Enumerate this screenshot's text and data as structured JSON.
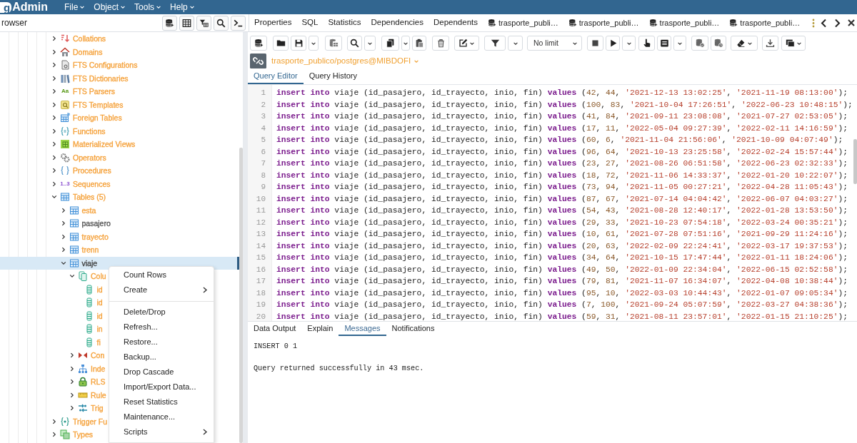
{
  "header": {
    "logo_badge": "g",
    "logo_text": "Admin",
    "menus": [
      "File",
      "Object",
      "Tools",
      "Help"
    ]
  },
  "browser": {
    "title": "rowser",
    "tree": [
      {
        "label": "Collations",
        "kind": "collation",
        "color": "#f5a23c",
        "expanded": false,
        "selected": false
      },
      {
        "label": "Domains",
        "kind": "domain",
        "color": "#f5a23c",
        "expanded": false,
        "selected": false
      },
      {
        "label": "FTS Configurations",
        "kind": "ftsconfig",
        "color": "#f5a23c",
        "expanded": false,
        "selected": false
      },
      {
        "label": "FTS Dictionaries",
        "kind": "ftsdict",
        "color": "#f5a23c",
        "expanded": false,
        "selected": false
      },
      {
        "label": "FTS Parsers",
        "kind": "ftsparser",
        "glyph": "Aa",
        "color": "#f5a23c",
        "expanded": false,
        "selected": false
      },
      {
        "label": "FTS Templates",
        "kind": "ftstemplate",
        "color": "#f5a23c",
        "expanded": false,
        "selected": false
      },
      {
        "label": "Foreign Tables",
        "kind": "foreigntable",
        "color": "#f5a23c",
        "expanded": false,
        "selected": false
      },
      {
        "label": "Functions",
        "kind": "function",
        "color": "#f5a23c",
        "expanded": false,
        "selected": false
      },
      {
        "label": "Materialized Views",
        "kind": "matview",
        "color": "#f5a23c",
        "expanded": false,
        "selected": false
      },
      {
        "label": "Operators",
        "kind": "operator",
        "color": "#f5a23c",
        "expanded": false,
        "selected": false
      },
      {
        "label": "Procedures",
        "kind": "procedure",
        "color": "#f5a23c",
        "expanded": false,
        "selected": false
      },
      {
        "label": "Sequences",
        "kind": "sequence",
        "glyph": "1..3",
        "color": "#f5a23c",
        "expanded": false,
        "selected": false
      },
      {
        "label": "Tables (5)",
        "kind": "tables",
        "color": "#f5a23c",
        "expanded": true,
        "selected": false,
        "children": [
          {
            "label": "esta",
            "kind": "table",
            "color": "#f5a23c",
            "expanded": false,
            "selected": false
          },
          {
            "label": "pasajero",
            "kind": "table",
            "color": "#555555",
            "expanded": false,
            "selected": false
          },
          {
            "label": "trayecto",
            "kind": "table",
            "color": "#f5a23c",
            "expanded": false,
            "selected": false
          },
          {
            "label": "trenn",
            "kind": "table",
            "color": "#f5a23c",
            "expanded": false,
            "selected": false
          },
          {
            "label": "viaje",
            "kind": "table",
            "color": "#444444",
            "expanded": true,
            "selected": true,
            "children": [
              {
                "label": "Colu",
                "kind": "columns",
                "color": "#f5a23c",
                "expanded": true,
                "selected": false,
                "children": [
                  {
                    "label": "id",
                    "kind": "column",
                    "color": "#f5a23c",
                    "selected": false
                  },
                  {
                    "label": "id",
                    "kind": "column",
                    "color": "#f5a23c",
                    "selected": false
                  },
                  {
                    "label": "id",
                    "kind": "column",
                    "color": "#f5a23c",
                    "selected": false
                  },
                  {
                    "label": "in",
                    "kind": "column",
                    "color": "#f5a23c",
                    "selected": false
                  },
                  {
                    "label": "fi",
                    "kind": "column",
                    "color": "#f5a23c",
                    "selected": false
                  }
                ]
              },
              {
                "label": "Con",
                "kind": "constraints",
                "color": "#f5a23c",
                "expanded": false,
                "selected": false
              },
              {
                "label": "Inde",
                "kind": "indexes",
                "color": "#f5a23c",
                "expanded": false,
                "selected": false
              },
              {
                "label": "RLS",
                "kind": "rls",
                "color": "#f5a23c",
                "expanded": false,
                "selected": false
              },
              {
                "label": "Rule",
                "kind": "rules",
                "color": "#f5a23c",
                "expanded": false,
                "selected": false
              },
              {
                "label": "Trig",
                "kind": "triggers",
                "color": "#f5a23c",
                "expanded": false,
                "selected": false
              }
            ]
          }
        ]
      },
      {
        "label": "Trigger Fu",
        "kind": "triggerfunction",
        "color": "#f5a23c",
        "expanded": false,
        "selected": false
      },
      {
        "label": "Types",
        "kind": "type",
        "color": "#f5a23c",
        "expanded": false,
        "selected": false
      }
    ]
  },
  "tabs": [
    {
      "label": "Properties",
      "kind": "panel"
    },
    {
      "label": "SQL",
      "kind": "panel"
    },
    {
      "label": "Statistics",
      "kind": "panel"
    },
    {
      "label": "Dependencies",
      "kind": "panel"
    },
    {
      "label": "Dependents",
      "kind": "panel"
    },
    {
      "label": "trasporte_publi…",
      "kind": "query"
    },
    {
      "label": "trasporte_publi…",
      "kind": "query"
    },
    {
      "label": "trasporte_publi…",
      "kind": "query"
    },
    {
      "label": "trasporte_publi…",
      "kind": "query"
    }
  ],
  "query_tool": {
    "row_limit": "No limit",
    "connection": "trasporte_publico/postgres@MIBDOFI",
    "tabs": [
      {
        "label": "Query Editor",
        "selected": true
      },
      {
        "label": "Query History",
        "selected": false
      }
    ],
    "lines": [
      {
        "number": "1",
        "tokens": [
          {
            "kind": "keyword",
            "text": "insert into"
          },
          {
            "kind": "plain",
            "text": " viaje (id_pasajero, id_trayecto, inio, fin) "
          },
          {
            "kind": "keyword",
            "text": "values"
          },
          {
            "kind": "plain",
            "text": " ("
          },
          {
            "kind": "number",
            "text": "42"
          },
          {
            "kind": "plain",
            "text": ", "
          },
          {
            "kind": "number",
            "text": "44"
          },
          {
            "kind": "plain",
            "text": ", "
          },
          {
            "kind": "string",
            "text": "'2021-12-13 13:02:25'"
          },
          {
            "kind": "plain",
            "text": ", "
          },
          {
            "kind": "string",
            "text": "'2021-11-19 08:13:00'"
          },
          {
            "kind": "plain",
            "text": ");"
          }
        ]
      },
      {
        "number": "2",
        "tokens": [
          {
            "kind": "keyword",
            "text": "insert into"
          },
          {
            "kind": "plain",
            "text": " viaje (id_pasajero, id_trayecto, inio, fin) "
          },
          {
            "kind": "keyword",
            "text": "values"
          },
          {
            "kind": "plain",
            "text": " ("
          },
          {
            "kind": "number",
            "text": "100"
          },
          {
            "kind": "plain",
            "text": ", "
          },
          {
            "kind": "number",
            "text": "83"
          },
          {
            "kind": "plain",
            "text": ", "
          },
          {
            "kind": "string",
            "text": "'2021-10-04 17:26:51'"
          },
          {
            "kind": "plain",
            "text": ", "
          },
          {
            "kind": "string",
            "text": "'2022-06-23 10:48:15'"
          },
          {
            "kind": "plain",
            "text": ");"
          }
        ]
      },
      {
        "number": "3",
        "tokens": [
          {
            "kind": "keyword",
            "text": "insert into"
          },
          {
            "kind": "plain",
            "text": " viaje (id_pasajero, id_trayecto, inio, fin) "
          },
          {
            "kind": "keyword",
            "text": "values"
          },
          {
            "kind": "plain",
            "text": " ("
          },
          {
            "kind": "number",
            "text": "41"
          },
          {
            "kind": "plain",
            "text": ", "
          },
          {
            "kind": "number",
            "text": "84"
          },
          {
            "kind": "plain",
            "text": ", "
          },
          {
            "kind": "string",
            "text": "'2021-09-11 23:08:08'"
          },
          {
            "kind": "plain",
            "text": ", "
          },
          {
            "kind": "string",
            "text": "'2021-07-27 02:53:05'"
          },
          {
            "kind": "plain",
            "text": ");"
          }
        ]
      },
      {
        "number": "4",
        "tokens": [
          {
            "kind": "keyword",
            "text": "insert into"
          },
          {
            "kind": "plain",
            "text": " viaje (id_pasajero, id_trayecto, inio, fin) "
          },
          {
            "kind": "keyword",
            "text": "values"
          },
          {
            "kind": "plain",
            "text": " ("
          },
          {
            "kind": "number",
            "text": "17"
          },
          {
            "kind": "plain",
            "text": ", "
          },
          {
            "kind": "number",
            "text": "11"
          },
          {
            "kind": "plain",
            "text": ", "
          },
          {
            "kind": "string",
            "text": "'2022-05-04 09:27:39'"
          },
          {
            "kind": "plain",
            "text": ", "
          },
          {
            "kind": "string",
            "text": "'2022-02-11 14:16:59'"
          },
          {
            "kind": "plain",
            "text": ");"
          }
        ]
      },
      {
        "number": "5",
        "tokens": [
          {
            "kind": "keyword",
            "text": "insert into"
          },
          {
            "kind": "plain",
            "text": " viaje (id_pasajero, id_trayecto, inio, fin) "
          },
          {
            "kind": "keyword",
            "text": "values"
          },
          {
            "kind": "plain",
            "text": " ("
          },
          {
            "kind": "number",
            "text": "60"
          },
          {
            "kind": "plain",
            "text": ", "
          },
          {
            "kind": "number",
            "text": "6"
          },
          {
            "kind": "plain",
            "text": ", "
          },
          {
            "kind": "string",
            "text": "'2021-11-04 21:56:06'"
          },
          {
            "kind": "plain",
            "text": ", "
          },
          {
            "kind": "string",
            "text": "'2021-10-09 04:07:49'"
          },
          {
            "kind": "plain",
            "text": ");"
          }
        ]
      },
      {
        "number": "6",
        "tokens": [
          {
            "kind": "keyword",
            "text": "insert into"
          },
          {
            "kind": "plain",
            "text": " viaje (id_pasajero, id_trayecto, inio, fin) "
          },
          {
            "kind": "keyword",
            "text": "values"
          },
          {
            "kind": "plain",
            "text": " ("
          },
          {
            "kind": "number",
            "text": "96"
          },
          {
            "kind": "plain",
            "text": ", "
          },
          {
            "kind": "number",
            "text": "64"
          },
          {
            "kind": "plain",
            "text": ", "
          },
          {
            "kind": "string",
            "text": "'2021-10-13 23:25:58'"
          },
          {
            "kind": "plain",
            "text": ", "
          },
          {
            "kind": "string",
            "text": "'2022-02-24 15:57:44'"
          },
          {
            "kind": "plain",
            "text": ");"
          }
        ]
      },
      {
        "number": "7",
        "tokens": [
          {
            "kind": "keyword",
            "text": "insert into"
          },
          {
            "kind": "plain",
            "text": " viaje (id_pasajero, id_trayecto, inio, fin) "
          },
          {
            "kind": "keyword",
            "text": "values"
          },
          {
            "kind": "plain",
            "text": " ("
          },
          {
            "kind": "number",
            "text": "23"
          },
          {
            "kind": "plain",
            "text": ", "
          },
          {
            "kind": "number",
            "text": "27"
          },
          {
            "kind": "plain",
            "text": ", "
          },
          {
            "kind": "string",
            "text": "'2021-08-26 06:51:58'"
          },
          {
            "kind": "plain",
            "text": ", "
          },
          {
            "kind": "string",
            "text": "'2022-06-23 02:32:33'"
          },
          {
            "kind": "plain",
            "text": ");"
          }
        ]
      },
      {
        "number": "8",
        "tokens": [
          {
            "kind": "keyword",
            "text": "insert into"
          },
          {
            "kind": "plain",
            "text": " viaje (id_pasajero, id_trayecto, inio, fin) "
          },
          {
            "kind": "keyword",
            "text": "values"
          },
          {
            "kind": "plain",
            "text": " ("
          },
          {
            "kind": "number",
            "text": "18"
          },
          {
            "kind": "plain",
            "text": ", "
          },
          {
            "kind": "number",
            "text": "72"
          },
          {
            "kind": "plain",
            "text": ", "
          },
          {
            "kind": "string",
            "text": "'2021-11-06 14:33:37'"
          },
          {
            "kind": "plain",
            "text": ", "
          },
          {
            "kind": "string",
            "text": "'2022-01-20 10:22:07'"
          },
          {
            "kind": "plain",
            "text": ");"
          }
        ]
      },
      {
        "number": "9",
        "tokens": [
          {
            "kind": "keyword",
            "text": "insert into"
          },
          {
            "kind": "plain",
            "text": " viaje (id_pasajero, id_trayecto, inio, fin) "
          },
          {
            "kind": "keyword",
            "text": "values"
          },
          {
            "kind": "plain",
            "text": " ("
          },
          {
            "kind": "number",
            "text": "73"
          },
          {
            "kind": "plain",
            "text": ", "
          },
          {
            "kind": "number",
            "text": "94"
          },
          {
            "kind": "plain",
            "text": ", "
          },
          {
            "kind": "string",
            "text": "'2021-11-05 00:27:21'"
          },
          {
            "kind": "plain",
            "text": ", "
          },
          {
            "kind": "string",
            "text": "'2022-04-28 11:05:43'"
          },
          {
            "kind": "plain",
            "text": ");"
          }
        ]
      },
      {
        "number": "10",
        "tokens": [
          {
            "kind": "keyword",
            "text": "insert into"
          },
          {
            "kind": "plain",
            "text": " viaje (id_pasajero, id_trayecto, inio, fin) "
          },
          {
            "kind": "keyword",
            "text": "values"
          },
          {
            "kind": "plain",
            "text": " ("
          },
          {
            "kind": "number",
            "text": "87"
          },
          {
            "kind": "plain",
            "text": ", "
          },
          {
            "kind": "number",
            "text": "67"
          },
          {
            "kind": "plain",
            "text": ", "
          },
          {
            "kind": "string",
            "text": "'2021-07-14 04:04:42'"
          },
          {
            "kind": "plain",
            "text": ", "
          },
          {
            "kind": "string",
            "text": "'2022-06-07 04:03:27'"
          },
          {
            "kind": "plain",
            "text": ");"
          }
        ]
      },
      {
        "number": "11",
        "tokens": [
          {
            "kind": "keyword",
            "text": "insert into"
          },
          {
            "kind": "plain",
            "text": " viaje (id_pasajero, id_trayecto, inio, fin) "
          },
          {
            "kind": "keyword",
            "text": "values"
          },
          {
            "kind": "plain",
            "text": " ("
          },
          {
            "kind": "number",
            "text": "54"
          },
          {
            "kind": "plain",
            "text": ", "
          },
          {
            "kind": "number",
            "text": "43"
          },
          {
            "kind": "plain",
            "text": ", "
          },
          {
            "kind": "string",
            "text": "'2021-08-28 12:40:17'"
          },
          {
            "kind": "plain",
            "text": ", "
          },
          {
            "kind": "string",
            "text": "'2022-01-28 13:53:50'"
          },
          {
            "kind": "plain",
            "text": ");"
          }
        ]
      },
      {
        "number": "12",
        "tokens": [
          {
            "kind": "keyword",
            "text": "insert into"
          },
          {
            "kind": "plain",
            "text": " viaje (id_pasajero, id_trayecto, inio, fin) "
          },
          {
            "kind": "keyword",
            "text": "values"
          },
          {
            "kind": "plain",
            "text": " ("
          },
          {
            "kind": "number",
            "text": "29"
          },
          {
            "kind": "plain",
            "text": ", "
          },
          {
            "kind": "number",
            "text": "33"
          },
          {
            "kind": "plain",
            "text": ", "
          },
          {
            "kind": "string",
            "text": "'2021-10-23 07:54:18'"
          },
          {
            "kind": "plain",
            "text": ", "
          },
          {
            "kind": "string",
            "text": "'2022-03-24 00:35:21'"
          },
          {
            "kind": "plain",
            "text": ");"
          }
        ]
      },
      {
        "number": "13",
        "tokens": [
          {
            "kind": "keyword",
            "text": "insert into"
          },
          {
            "kind": "plain",
            "text": " viaje (id_pasajero, id_trayecto, inio, fin) "
          },
          {
            "kind": "keyword",
            "text": "values"
          },
          {
            "kind": "plain",
            "text": " ("
          },
          {
            "kind": "number",
            "text": "10"
          },
          {
            "kind": "plain",
            "text": ", "
          },
          {
            "kind": "number",
            "text": "61"
          },
          {
            "kind": "plain",
            "text": ", "
          },
          {
            "kind": "string",
            "text": "'2021-07-28 07:51:16'"
          },
          {
            "kind": "plain",
            "text": ", "
          },
          {
            "kind": "string",
            "text": "'2021-09-29 11:24:16'"
          },
          {
            "kind": "plain",
            "text": ");"
          }
        ]
      },
      {
        "number": "14",
        "tokens": [
          {
            "kind": "keyword",
            "text": "insert into"
          },
          {
            "kind": "plain",
            "text": " viaje (id_pasajero, id_trayecto, inio, fin) "
          },
          {
            "kind": "keyword",
            "text": "values"
          },
          {
            "kind": "plain",
            "text": " ("
          },
          {
            "kind": "number",
            "text": "20"
          },
          {
            "kind": "plain",
            "text": ", "
          },
          {
            "kind": "number",
            "text": "63"
          },
          {
            "kind": "plain",
            "text": ", "
          },
          {
            "kind": "string",
            "text": "'2022-02-09 22:24:41'"
          },
          {
            "kind": "plain",
            "text": ", "
          },
          {
            "kind": "string",
            "text": "'2022-03-17 19:37:53'"
          },
          {
            "kind": "plain",
            "text": ");"
          }
        ]
      },
      {
        "number": "15",
        "tokens": [
          {
            "kind": "keyword",
            "text": "insert into"
          },
          {
            "kind": "plain",
            "text": " viaje (id_pasajero, id_trayecto, inio, fin) "
          },
          {
            "kind": "keyword",
            "text": "values"
          },
          {
            "kind": "plain",
            "text": " ("
          },
          {
            "kind": "number",
            "text": "34"
          },
          {
            "kind": "plain",
            "text": ", "
          },
          {
            "kind": "number",
            "text": "64"
          },
          {
            "kind": "plain",
            "text": ", "
          },
          {
            "kind": "string",
            "text": "'2021-10-15 17:47:44'"
          },
          {
            "kind": "plain",
            "text": ", "
          },
          {
            "kind": "string",
            "text": "'2022-01-11 18:24:06'"
          },
          {
            "kind": "plain",
            "text": ");"
          }
        ]
      },
      {
        "number": "16",
        "tokens": [
          {
            "kind": "keyword",
            "text": "insert into"
          },
          {
            "kind": "plain",
            "text": " viaje (id_pasajero, id_trayecto, inio, fin) "
          },
          {
            "kind": "keyword",
            "text": "values"
          },
          {
            "kind": "plain",
            "text": " ("
          },
          {
            "kind": "number",
            "text": "49"
          },
          {
            "kind": "plain",
            "text": ", "
          },
          {
            "kind": "number",
            "text": "50"
          },
          {
            "kind": "plain",
            "text": ", "
          },
          {
            "kind": "string",
            "text": "'2022-01-09 22:34:04'"
          },
          {
            "kind": "plain",
            "text": ", "
          },
          {
            "kind": "string",
            "text": "'2022-06-15 02:52:58'"
          },
          {
            "kind": "plain",
            "text": ");"
          }
        ]
      },
      {
        "number": "17",
        "tokens": [
          {
            "kind": "keyword",
            "text": "insert into"
          },
          {
            "kind": "plain",
            "text": " viaje (id_pasajero, id_trayecto, inio, fin) "
          },
          {
            "kind": "keyword",
            "text": "values"
          },
          {
            "kind": "plain",
            "text": " ("
          },
          {
            "kind": "number",
            "text": "79"
          },
          {
            "kind": "plain",
            "text": ", "
          },
          {
            "kind": "number",
            "text": "81"
          },
          {
            "kind": "plain",
            "text": ", "
          },
          {
            "kind": "string",
            "text": "'2021-11-07 16:34:07'"
          },
          {
            "kind": "plain",
            "text": ", "
          },
          {
            "kind": "string",
            "text": "'2022-04-08 10:38:44'"
          },
          {
            "kind": "plain",
            "text": ");"
          }
        ]
      },
      {
        "number": "18",
        "tokens": [
          {
            "kind": "keyword",
            "text": "insert into"
          },
          {
            "kind": "plain",
            "text": " viaje (id_pasajero, id_trayecto, inio, fin) "
          },
          {
            "kind": "keyword",
            "text": "values"
          },
          {
            "kind": "plain",
            "text": " ("
          },
          {
            "kind": "number",
            "text": "95"
          },
          {
            "kind": "plain",
            "text": ", "
          },
          {
            "kind": "number",
            "text": "10"
          },
          {
            "kind": "plain",
            "text": ", "
          },
          {
            "kind": "string",
            "text": "'2022-03-03 10:44:43'"
          },
          {
            "kind": "plain",
            "text": ", "
          },
          {
            "kind": "string",
            "text": "'2022-01-07 09:05:34'"
          },
          {
            "kind": "plain",
            "text": ");"
          }
        ]
      },
      {
        "number": "19",
        "tokens": [
          {
            "kind": "keyword",
            "text": "insert into"
          },
          {
            "kind": "plain",
            "text": " viaje (id_pasajero, id_trayecto, inio, fin) "
          },
          {
            "kind": "keyword",
            "text": "values"
          },
          {
            "kind": "plain",
            "text": " ("
          },
          {
            "kind": "number",
            "text": "7"
          },
          {
            "kind": "plain",
            "text": ", "
          },
          {
            "kind": "number",
            "text": "100"
          },
          {
            "kind": "plain",
            "text": ", "
          },
          {
            "kind": "string",
            "text": "'2021-09-24 05:07:59'"
          },
          {
            "kind": "plain",
            "text": ", "
          },
          {
            "kind": "string",
            "text": "'2022-03-27 04:38:36'"
          },
          {
            "kind": "plain",
            "text": ");"
          }
        ]
      },
      {
        "number": "20",
        "tokens": [
          {
            "kind": "keyword",
            "text": "insert into"
          },
          {
            "kind": "plain",
            "text": " viaje (id_pasajero, id_trayecto, inio, fin) "
          },
          {
            "kind": "keyword",
            "text": "values"
          },
          {
            "kind": "plain",
            "text": " ("
          },
          {
            "kind": "number",
            "text": "59"
          },
          {
            "kind": "plain",
            "text": ", "
          },
          {
            "kind": "number",
            "text": "31"
          },
          {
            "kind": "plain",
            "text": ", "
          },
          {
            "kind": "string",
            "text": "'2021-08-11 23:57:01'"
          },
          {
            "kind": "plain",
            "text": ", "
          },
          {
            "kind": "string",
            "text": "'2022-01-15 21:10:25'"
          },
          {
            "kind": "plain",
            "text": ");"
          }
        ]
      }
    ],
    "output_tabs": [
      {
        "label": "Data Output",
        "selected": false
      },
      {
        "label": "Explain",
        "selected": false
      },
      {
        "label": "Messages",
        "selected": true
      },
      {
        "label": "Notifications",
        "selected": false
      }
    ],
    "messages": [
      "INSERT 0 1",
      "Query returned successfully in 43 msec."
    ]
  },
  "context_menu": {
    "items": [
      {
        "kind": "item",
        "label": "Count Rows",
        "submenu": false
      },
      {
        "kind": "item",
        "label": "Create",
        "submenu": true
      },
      {
        "kind": "separator"
      },
      {
        "kind": "item",
        "label": "Delete/Drop",
        "submenu": false
      },
      {
        "kind": "item",
        "label": "Refresh...",
        "submenu": false
      },
      {
        "kind": "item",
        "label": "Restore...",
        "submenu": false
      },
      {
        "kind": "item",
        "label": "Backup...",
        "submenu": false
      },
      {
        "kind": "item",
        "label": "Drop Cascade",
        "submenu": false
      },
      {
        "kind": "item",
        "label": "Import/Export Data...",
        "submenu": false
      },
      {
        "kind": "item",
        "label": "Reset Statistics",
        "submenu": false
      },
      {
        "kind": "item",
        "label": "Maintenance...",
        "submenu": false
      },
      {
        "kind": "item",
        "label": "Scripts",
        "submenu": true
      }
    ]
  }
}
